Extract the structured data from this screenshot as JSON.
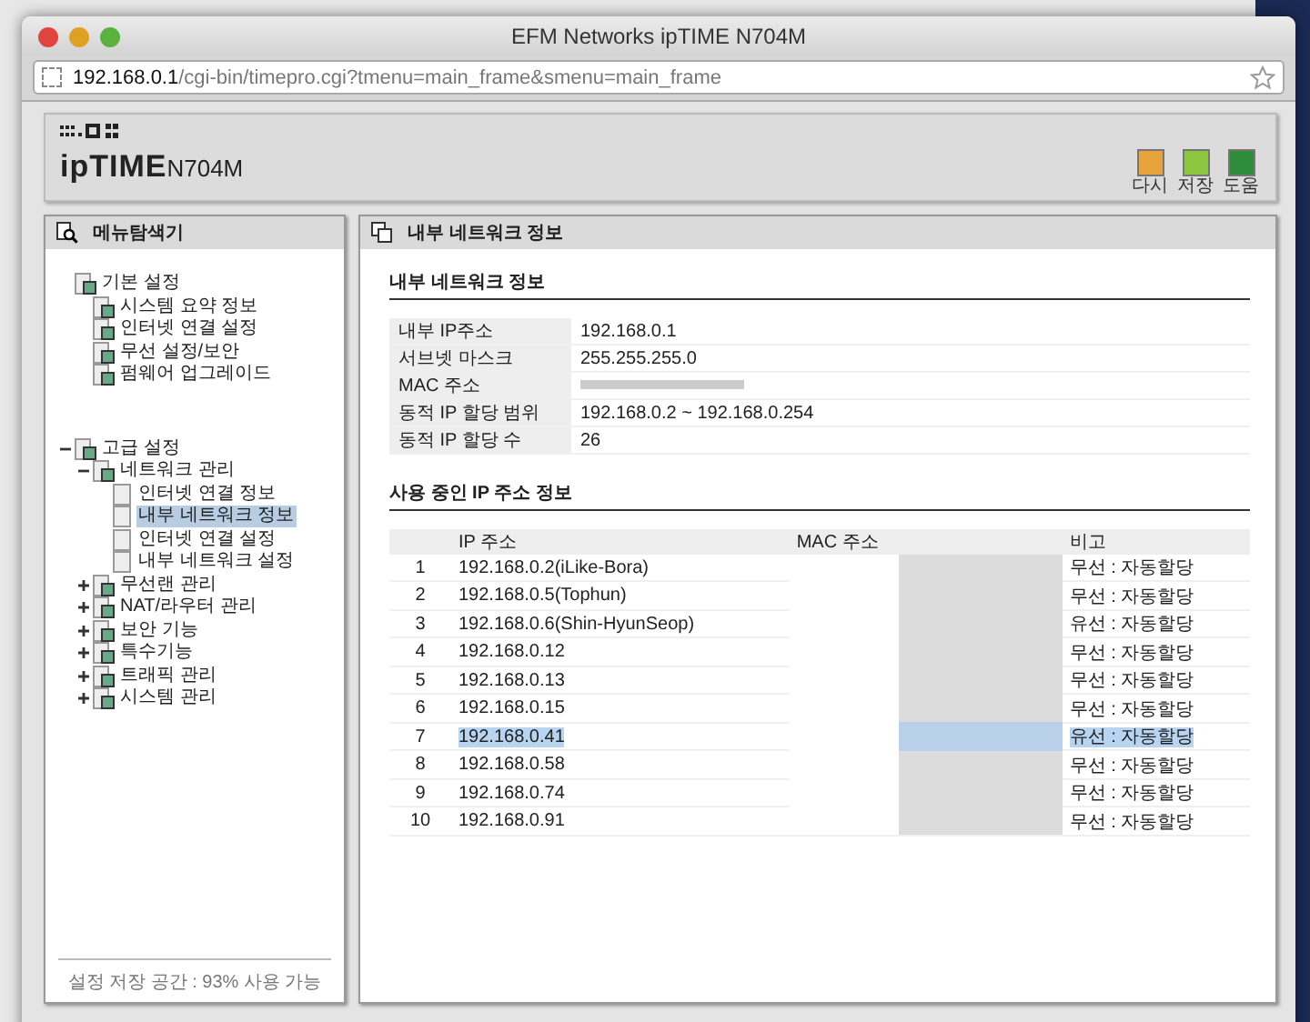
{
  "window": {
    "title": "EFM Networks ipTIME N704M"
  },
  "address_bar": {
    "url": "**192.168.0.1**/cgi-bin/timepro.cgi?tmenu=main_frame&smenu=main_frame"
  },
  "header": {
    "brand": "ipTIME",
    "model": "N704M",
    "buttons": [
      {
        "label": "다시",
        "color": "#e8a43a"
      },
      {
        "label": "저장",
        "color": "#8cc63f"
      },
      {
        "label": "도움",
        "color": "#2e8b3a"
      }
    ]
  },
  "sidebar": {
    "title": "메뉴탐색기",
    "items": [
      {
        "label": "기본 설정",
        "selected": false,
        "children": [
          {
            "label": "시스템 요약 정보",
            "selected": false
          },
          {
            "label": "인터넷 연결 설정",
            "selected": false
          },
          {
            "label": "무선 설정/보안",
            "selected": false
          },
          {
            "label": "펌웨어 업그레이드",
            "selected": false
          }
        ]
      },
      {
        "label": "고급 설정",
        "expanded": true,
        "selected": false,
        "children": [
          {
            "label": "네트워크 관리",
            "expanded": true,
            "selected": false,
            "children": [
              {
                "label": "인터넷 연결 정보",
                "selected": false
              },
              {
                "label": "내부 네트워크 정보",
                "selected": true
              },
              {
                "label": "인터넷 연결 설정",
                "selected": false
              },
              {
                "label": "내부 네트워크 설정",
                "selected": false
              }
            ]
          },
          {
            "label": "무선랜 관리",
            "expanded": false,
            "selected": false
          },
          {
            "label": "NAT/라우터 관리",
            "expanded": false,
            "selected": false
          },
          {
            "label": "보안 기능",
            "expanded": false,
            "selected": false
          },
          {
            "label": "특수기능",
            "expanded": false,
            "selected": false
          },
          {
            "label": "트래픽 관리",
            "expanded": false,
            "selected": false
          },
          {
            "label": "시스템 관리",
            "expanded": false,
            "selected": false
          }
        ]
      }
    ],
    "footer": "설정 저장 공간 : 93% 사용 가능"
  },
  "main": {
    "title": "내부 네트워크 정보",
    "info_section": {
      "heading": "내부 네트워크 정보",
      "rows": [
        {
          "label": "내부 IP주소",
          "value": "192.168.0.1",
          "blurred": false
        },
        {
          "label": "서브넷 마스크",
          "value": "255.255.255.0",
          "blurred": false
        },
        {
          "label": "MAC 주소",
          "blurred": true
        },
        {
          "label": "동적 IP 할당 범위",
          "value": "192.168.0.2 ~  192.168.0.254",
          "blurred": false
        },
        {
          "label": "동적 IP 할당 수",
          "value": "26",
          "blurred": false
        }
      ]
    },
    "clients_section": {
      "heading": "사용 중인 IP 주소 정보",
      "columns": [
        "IP 주소",
        "MAC 주소",
        "비고"
      ],
      "rows": [
        {
          "no": "1",
          "ip": "192.168.0.2(iLike-Bora)",
          "note": "무선 : 자동할당",
          "selected": false
        },
        {
          "no": "2",
          "ip": "192.168.0.5(Tophun)",
          "note": "무선 : 자동할당",
          "selected": false
        },
        {
          "no": "3",
          "ip": "192.168.0.6(Shin-HyunSeop)",
          "note": "유선 : 자동할당",
          "selected": false
        },
        {
          "no": "4",
          "ip": "192.168.0.12",
          "note": "무선 : 자동할당",
          "selected": false
        },
        {
          "no": "5",
          "ip": "192.168.0.13",
          "note": "무선 : 자동할당",
          "selected": false
        },
        {
          "no": "6",
          "ip": "192.168.0.15",
          "note": "무선 : 자동할당",
          "selected": false
        },
        {
          "no": "7",
          "ip": "192.168.0.41",
          "note": "유선 : 자동할당",
          "selected": true
        },
        {
          "no": "8",
          "ip": "192.168.0.58",
          "note": "무선 : 자동할당",
          "selected": false
        },
        {
          "no": "9",
          "ip": "192.168.0.74",
          "note": "무선 : 자동할당",
          "selected": false
        },
        {
          "no": "10",
          "ip": "192.168.0.91",
          "note": "무선 : 자동할당",
          "selected": false
        }
      ]
    }
  }
}
